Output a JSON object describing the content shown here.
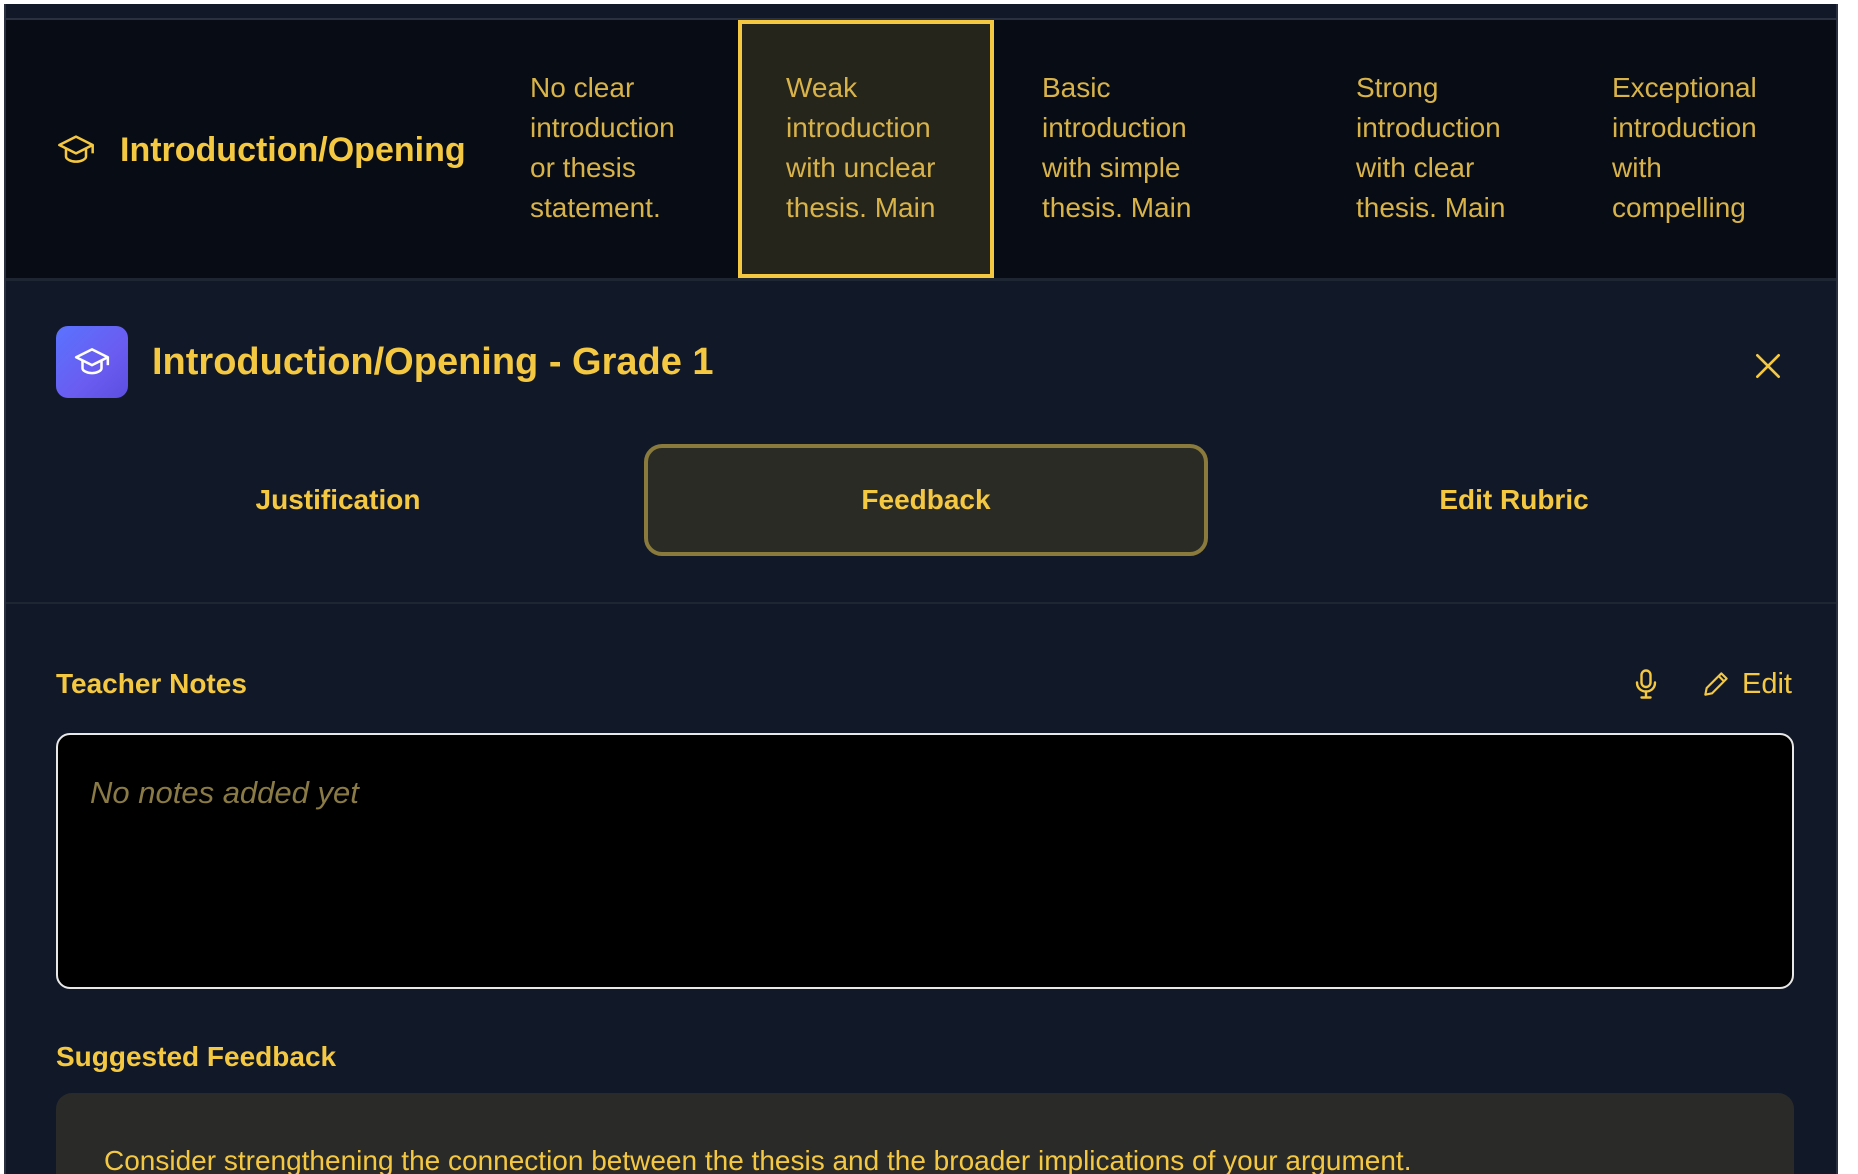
{
  "rubric_row": {
    "criterion": "Introduction/Opening",
    "criterion_icon": "graduation-cap-icon",
    "levels": [
      {
        "text": "No clear\nintroduction\nor thesis\nstatement.",
        "selected": false
      },
      {
        "text": "Weak\nintroduction\nwith unclear\nthesis. Main",
        "selected": true
      },
      {
        "text": "Basic\nintroduction\nwith simple\nthesis. Main",
        "selected": false
      },
      {
        "text": "Strong\nintroduction\nwith clear\nthesis. Main",
        "selected": false
      },
      {
        "text": "Exceptional\nintroduction\nwith\ncompelling",
        "selected": false
      }
    ]
  },
  "panel": {
    "title": "Introduction/Opening - Grade 1",
    "badge_icon": "graduation-cap-icon",
    "close_icon": "close-icon"
  },
  "tabs": [
    {
      "label": "Justification",
      "active": false
    },
    {
      "label": "Feedback",
      "active": true
    },
    {
      "label": "Edit Rubric",
      "active": false
    }
  ],
  "teacher_notes": {
    "label": "Teacher Notes",
    "mic_icon": "microphone-icon",
    "edit_label": "Edit",
    "placeholder": "No notes added yet"
  },
  "suggested_feedback": {
    "label": "Suggested Feedback",
    "text": "Consider strengthening the connection between the thesis and the broader implications of your argument."
  },
  "colors": {
    "accent": "#f5c842",
    "background": "#111827",
    "badge": "#5a73ff"
  }
}
